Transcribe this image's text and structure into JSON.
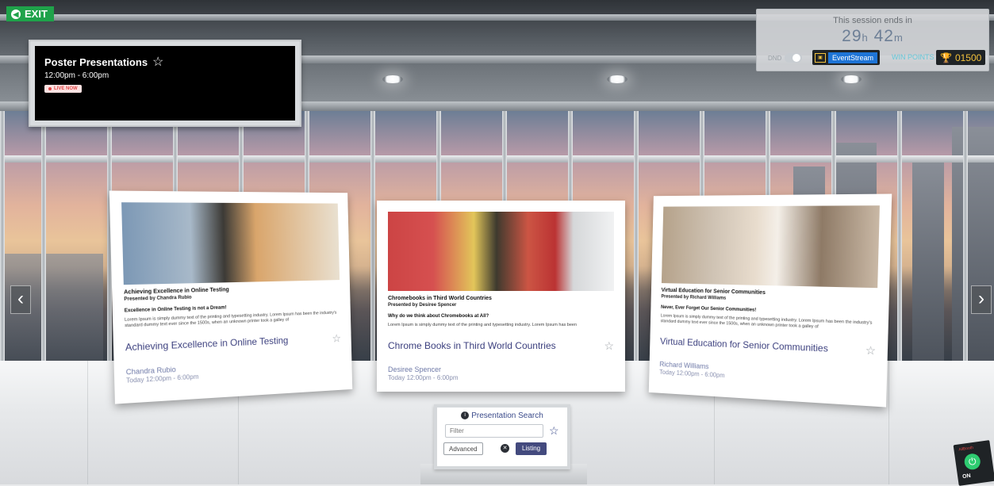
{
  "exit": {
    "label": "EXIT"
  },
  "sign": {
    "title": "Poster Presentations",
    "time": "12:00pm - 6:00pm",
    "live": "LIVE NOW"
  },
  "session": {
    "ends_label": "This session ends in",
    "hours": "29",
    "hours_unit": "h",
    "minutes": "42",
    "minutes_unit": "m",
    "dnd": "DND",
    "eventstream": "EventStream",
    "win_points_label": "WIN POINTS",
    "win_points": "01500"
  },
  "nav": {
    "prev": "‹",
    "next": "›"
  },
  "cards": [
    {
      "poster_title": "Achieving Excellence in Online Testing",
      "poster_by": "Presented by Chandra Rubio",
      "poster_heading": "Excellence in Online Testing is not a Dream!",
      "poster_body": "Lorem Ipsum is simply dummy text of the printing and typesetting industry. Lorem Ipsum has been the industry's standard dummy text ever since the 1500s, when an unknown printer took a galley of",
      "title": "Achieving Excellence in Online Testing",
      "presenter": "Chandra Rubio",
      "when": "Today 12:00pm - 6:00pm"
    },
    {
      "poster_title": "Chromebooks in Third World Countries",
      "poster_by": "Presented by Desiree Spencer",
      "poster_heading": "Why do we think about Chromebooks at All?",
      "poster_body": "Lorem Ipsum is simply dummy text of the printing and typesetting industry. Lorem Ipsum has been",
      "title": "Chrome Books in Third World Countries",
      "presenter": "Desiree Spencer",
      "when": "Today 12:00pm - 6:00pm"
    },
    {
      "poster_title": "Virtual Education for Senior Communities",
      "poster_by": "Presented by Richard Williams",
      "poster_heading": "Never, Ever Forget Our Senior Communities!",
      "poster_body": "Lorem Ipsum is simply dummy text of the printing and typesetting industry. Lorem Ipsum has been the industry's standard dummy text ever since the 1500s, when an unknown printer took a galley of",
      "title": "Virtual Education for Senior Communities",
      "presenter": "Richard Williams",
      "when": "Today 12:00pm - 6:00pm"
    }
  ],
  "search": {
    "title": "Presentation Search",
    "filter_placeholder": "Filter",
    "advanced": "Advanced",
    "listing": "Listing"
  },
  "power": {
    "brand": "AllBooth",
    "state": "ON"
  },
  "colors": {
    "exit_green": "#1fa24a",
    "eventstream_blue": "#1e74d6",
    "points_gold": "#f3c23c",
    "listing_navy": "#434a7e",
    "title_navy": "#3b3f7e"
  }
}
